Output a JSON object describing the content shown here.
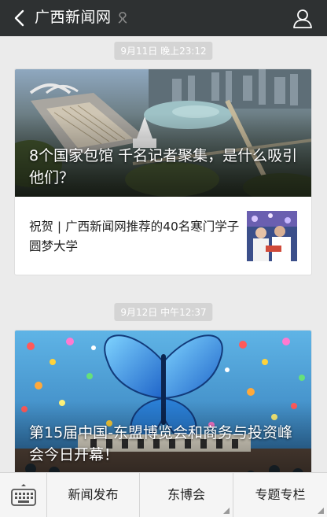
{
  "header": {
    "title": "广西新闻网",
    "back_icon": "back-chevron-icon",
    "verify_icon": "verified-badge-icon",
    "profile_icon": "profile-icon",
    "bg_color": "#2e3132"
  },
  "feed": [
    {
      "timestamp": "9月11日 晚上23:12",
      "hero_title": "8个国家包馆 千名记者聚集，是什么吸引他们？",
      "sub_item": "祝贺 | 广西新闻网推荐的40名寒门学子圆梦大学"
    },
    {
      "timestamp": "9月12日 中午12:37",
      "hero_title": "第15届中国-东盟博览会和商务与投资峰会今日开幕！"
    }
  ],
  "bottom_menu": {
    "keyboard_icon": "keyboard-icon",
    "items": [
      "新闻发布",
      "东博会",
      "专题专栏"
    ]
  }
}
